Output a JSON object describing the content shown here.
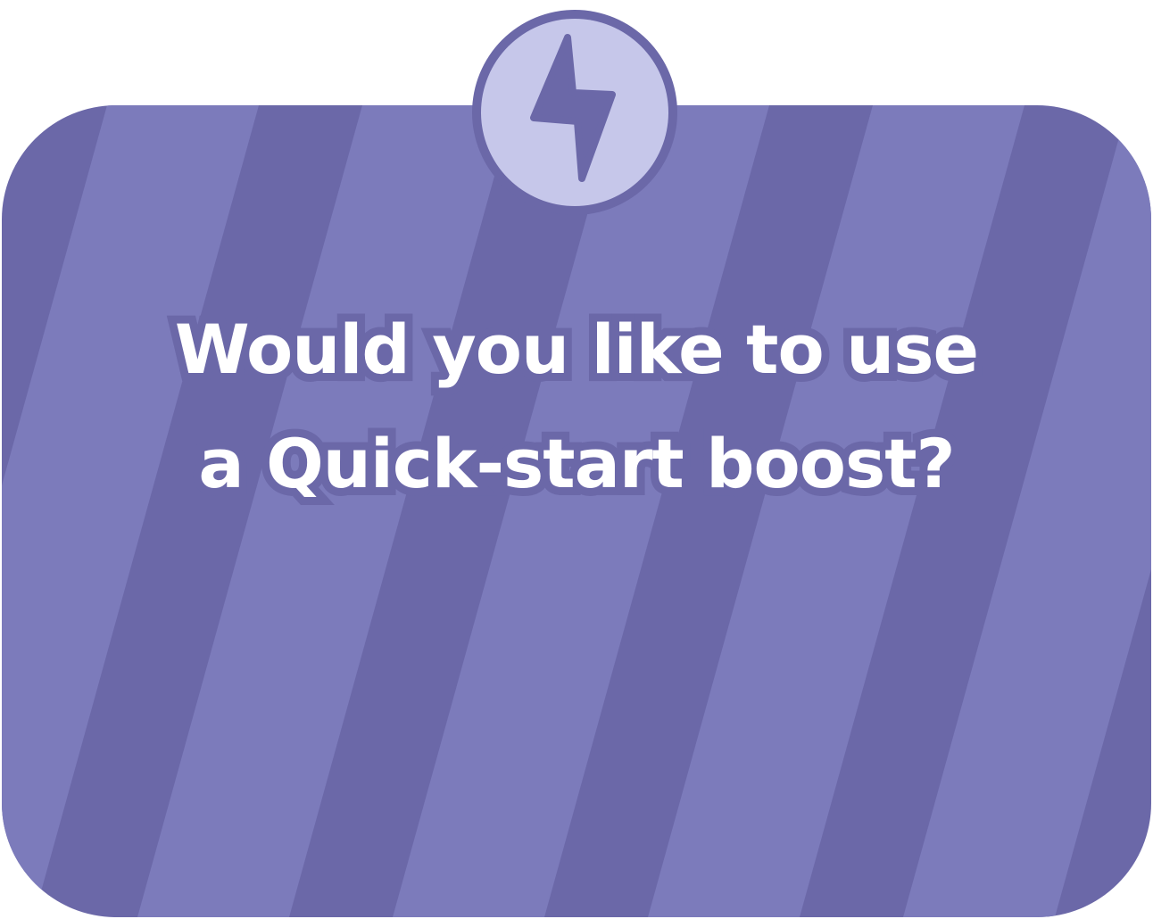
{
  "dialog": {
    "headline_line1": "Would you like to use",
    "headline_line2": "a Quick-start boost?"
  },
  "badge": {
    "icon": "lightning-bolt-icon"
  },
  "colors": {
    "panel_dark_stripe": "#6b68a8",
    "panel_light_stripe": "#7c7bbb",
    "badge_fill": "#c6c7ea",
    "badge_outline": "#6b68a8",
    "bolt": "#6b68a8",
    "text": "#ffffff"
  }
}
